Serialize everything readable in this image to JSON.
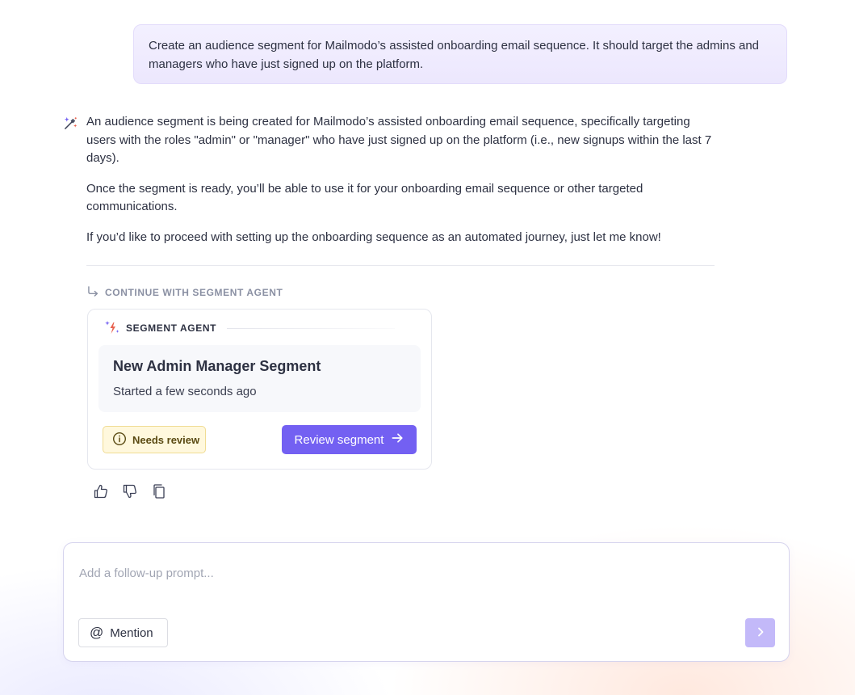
{
  "user_message": {
    "text": "Create an audience segment for Mailmodo’s assisted onboarding email sequence. It should target the admins and managers who have just signed up on the platform."
  },
  "assistant": {
    "icon": "magic-wand-icon",
    "paragraphs": [
      "An audience segment is being created for Mailmodo’s assisted onboarding email sequence, specifically targeting users with the roles \"admin\" or \"manager\" who have just signed up on the platform (i.e., new signups within the last 7 days).",
      "Once the segment is ready, you’ll be able to use it for your onboarding email sequence or other targeted communications.",
      "If you’d like to proceed with setting up the onboarding sequence as an automated journey, just let me know!"
    ],
    "continue_label": "CONTINUE WITH SEGMENT AGENT"
  },
  "agent_card": {
    "header": "SEGMENT AGENT",
    "segment_name": "New Admin Manager Segment",
    "status_time": "Started a few seconds ago",
    "badge": "Needs review",
    "button_label": "Review segment"
  },
  "feedback": {
    "icons": [
      "thumbs-up-icon",
      "thumbs-down-icon",
      "copy-icon"
    ]
  },
  "composer": {
    "placeholder": "Add a follow-up prompt...",
    "mention_label": "Mention",
    "mention_symbol": "@"
  },
  "colors": {
    "accent": "#7360f2",
    "accent_disabled": "#c3b9f9",
    "user_bubble": "#efeafe",
    "badge_bg": "#fff8dd",
    "badge_border": "#f0dc93"
  }
}
